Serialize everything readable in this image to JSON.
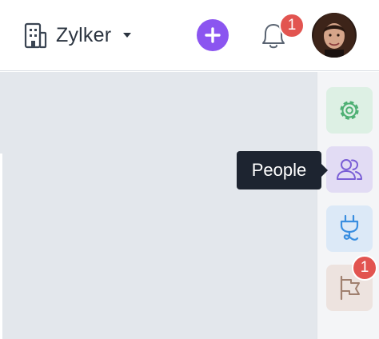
{
  "header": {
    "org_name": "Zylker",
    "notification_count": "1"
  },
  "rail": {
    "items": [
      {
        "icon": "gear-icon",
        "color": "#4caf72"
      },
      {
        "icon": "people-icon",
        "color": "#7a5fd6",
        "tooltip": "People"
      },
      {
        "icon": "plug-icon",
        "color": "#3a8ee0"
      },
      {
        "icon": "flag-icon",
        "color": "#a0806f",
        "badge": "1"
      }
    ]
  },
  "colors": {
    "accent": "#8b55f0",
    "badge": "#e25450",
    "tooltip_bg": "#1d2430"
  }
}
